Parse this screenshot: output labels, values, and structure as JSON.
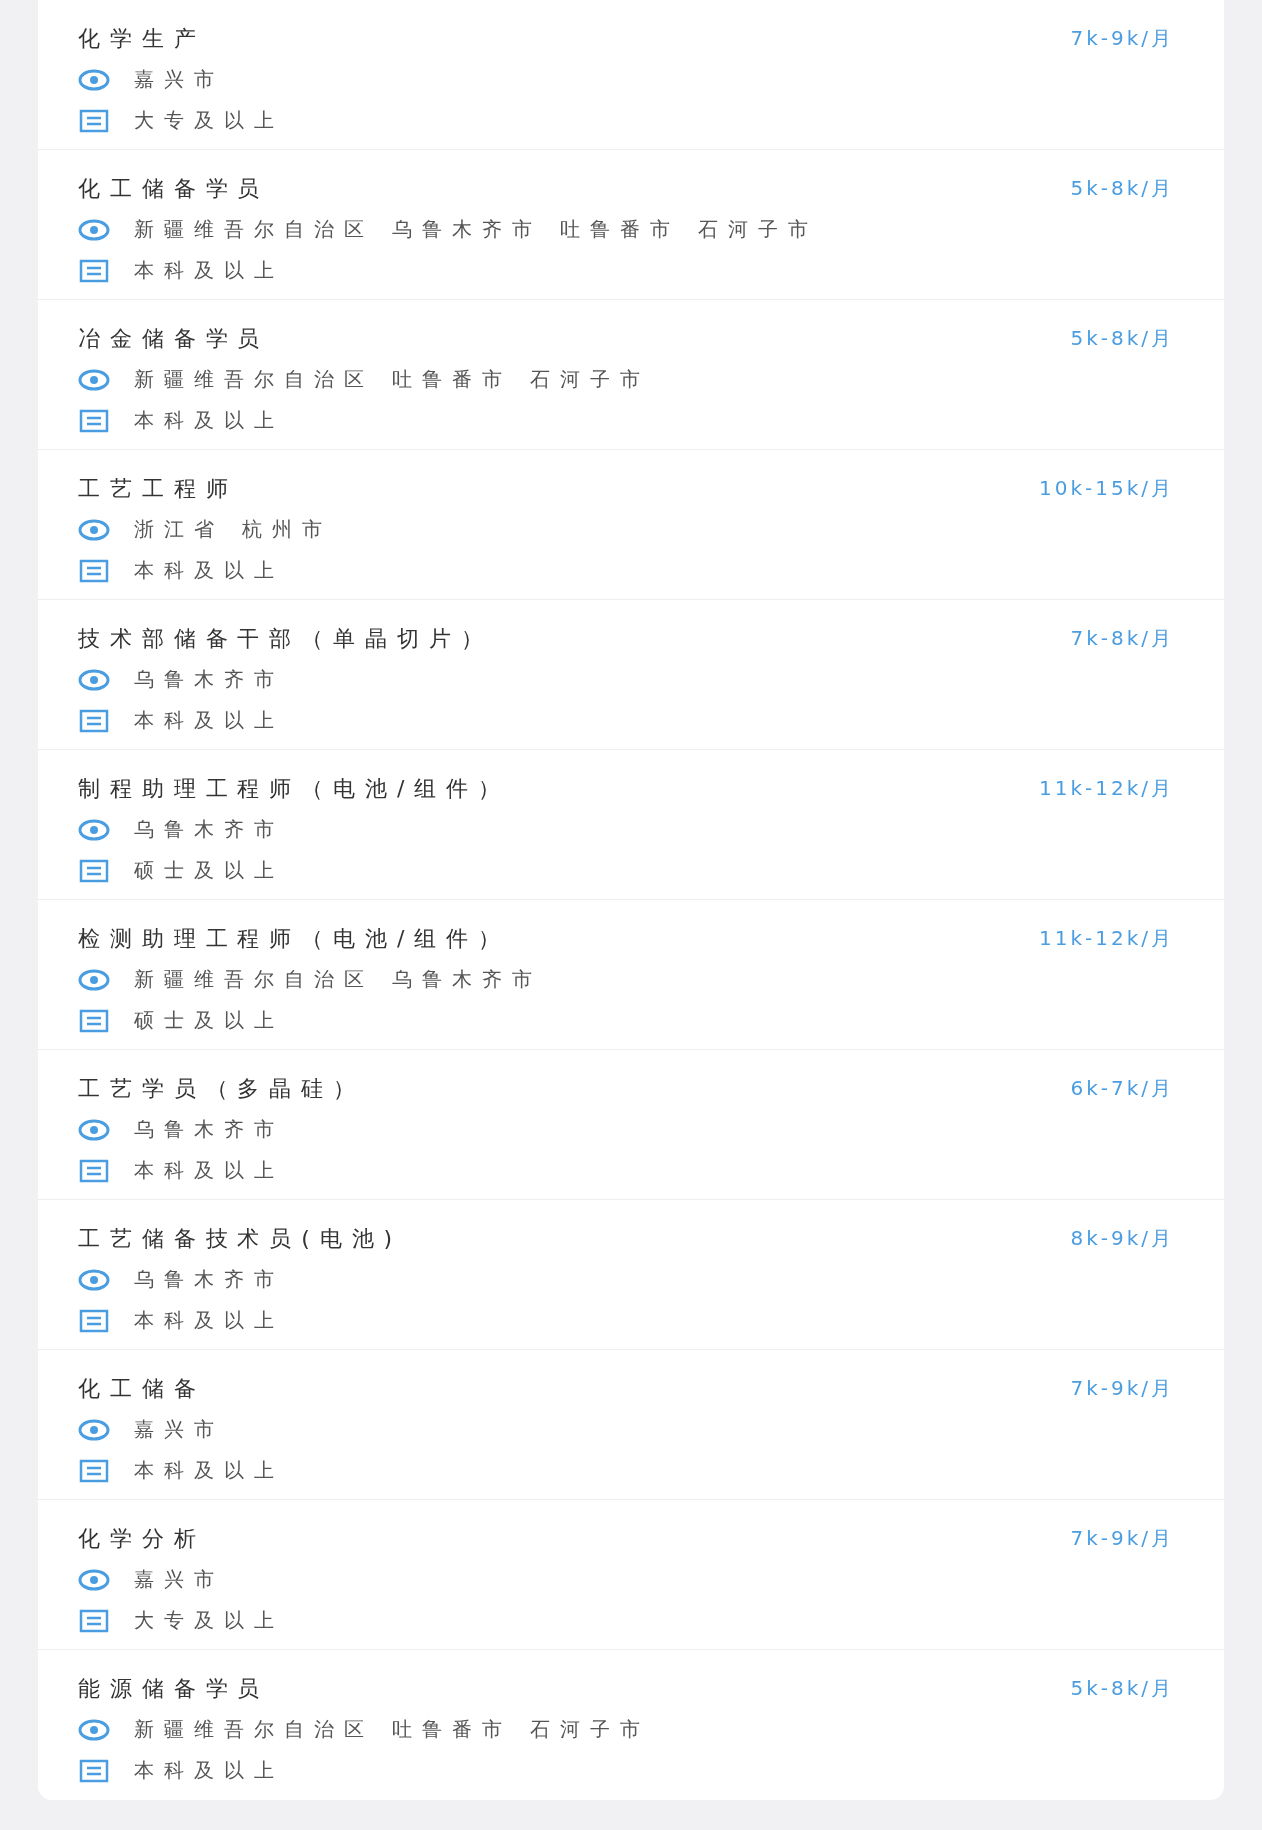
{
  "jobs": [
    {
      "title": "化学生产",
      "salary": "7k-9k/月",
      "locations": [
        "嘉兴市"
      ],
      "education": "大专及以上"
    },
    {
      "title": "化工储备学员",
      "salary": "5k-8k/月",
      "locations": [
        "新疆维吾尔自治区",
        "乌鲁木齐市",
        "吐鲁番市",
        "石河子市"
      ],
      "education": "本科及以上"
    },
    {
      "title": "冶金储备学员",
      "salary": "5k-8k/月",
      "locations": [
        "新疆维吾尔自治区",
        "吐鲁番市",
        "石河子市"
      ],
      "education": "本科及以上"
    },
    {
      "title": "工艺工程师",
      "salary": "10k-15k/月",
      "locations": [
        "浙江省",
        "杭州市"
      ],
      "education": "本科及以上"
    },
    {
      "title": "技术部储备干部（单晶切片）",
      "salary": "7k-8k/月",
      "locations": [
        "乌鲁木齐市"
      ],
      "education": "本科及以上"
    },
    {
      "title": "制程助理工程师（电池/组件）",
      "salary": "11k-12k/月",
      "locations": [
        "乌鲁木齐市"
      ],
      "education": "硕士及以上"
    },
    {
      "title": "检测助理工程师（电池/组件）",
      "salary": "11k-12k/月",
      "locations": [
        "新疆维吾尔自治区",
        "乌鲁木齐市"
      ],
      "education": "硕士及以上"
    },
    {
      "title": "工艺学员（多晶硅）",
      "salary": "6k-7k/月",
      "locations": [
        "乌鲁木齐市"
      ],
      "education": "本科及以上"
    },
    {
      "title": "工艺储备技术员(电池)",
      "salary": "8k-9k/月",
      "locations": [
        "乌鲁木齐市"
      ],
      "education": "本科及以上"
    },
    {
      "title": "化工储备",
      "salary": "7k-9k/月",
      "locations": [
        "嘉兴市"
      ],
      "education": "本科及以上"
    },
    {
      "title": "化学分析",
      "salary": "7k-9k/月",
      "locations": [
        "嘉兴市"
      ],
      "education": "大专及以上"
    },
    {
      "title": "能源储备学员",
      "salary": "5k-8k/月",
      "locations": [
        "新疆维吾尔自治区",
        "吐鲁番市",
        "石河子市"
      ],
      "education": "本科及以上"
    }
  ]
}
